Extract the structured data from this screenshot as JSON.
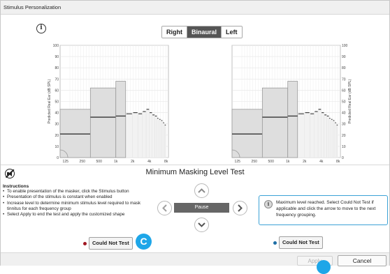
{
  "window": {
    "title": "Stimulus Personalization"
  },
  "ear_selector": {
    "options": [
      "Right",
      "Binaural",
      "Left"
    ],
    "selected": "Binaural"
  },
  "chart_data": [
    {
      "type": "bar",
      "ear": "right",
      "ylabel": "Predicted Real Ear (dB SPL)",
      "ylim": [
        0,
        100
      ],
      "yticks": [
        "0",
        "10",
        "20",
        "30",
        "40",
        "50",
        "60",
        "70",
        "80",
        "90",
        "100"
      ],
      "xticks": [
        "125",
        "250",
        "500",
        "1k",
        "2k",
        "4k",
        "8k"
      ],
      "bands": [
        {
          "from_hz": 100,
          "to_hz": 350,
          "top": 43,
          "level": 21
        },
        {
          "from_hz": 350,
          "to_hz": 1000,
          "top": 62,
          "level": 36
        },
        {
          "from_hz": 1000,
          "to_hz": 1500,
          "top": 68,
          "level": 37
        }
      ],
      "steps": [
        {
          "hz": 1750,
          "value": 39
        },
        {
          "hz": 2250,
          "value": 40
        },
        {
          "hz": 2750,
          "value": 39
        },
        {
          "hz": 3250,
          "value": 41
        },
        {
          "hz": 3750,
          "value": 43
        },
        {
          "hz": 4250,
          "value": 40
        },
        {
          "hz": 4750,
          "value": 38
        },
        {
          "hz": 5250,
          "value": 37
        },
        {
          "hz": 5750,
          "value": 35
        },
        {
          "hz": 6250,
          "value": 34
        },
        {
          "hz": 6750,
          "value": 33
        },
        {
          "hz": 7250,
          "value": 31
        },
        {
          "hz": 7750,
          "value": 29
        }
      ]
    },
    {
      "type": "bar",
      "ear": "left",
      "ylabel": "Predicted Real Ear (dB SPL)",
      "ylim": [
        0,
        100
      ],
      "yticks": [
        "0",
        "10",
        "20",
        "30",
        "40",
        "50",
        "60",
        "70",
        "80",
        "90",
        "100"
      ],
      "xticks": [
        "125",
        "250",
        "500",
        "1k",
        "2k",
        "4k",
        "8k"
      ],
      "bands": [
        {
          "from_hz": 100,
          "to_hz": 350,
          "top": 43,
          "level": 21
        },
        {
          "from_hz": 350,
          "to_hz": 1000,
          "top": 62,
          "level": 36
        },
        {
          "from_hz": 1000,
          "to_hz": 1500,
          "top": 68,
          "level": 37
        }
      ],
      "steps": [
        {
          "hz": 1750,
          "value": 39
        },
        {
          "hz": 2250,
          "value": 40
        },
        {
          "hz": 2750,
          "value": 39
        },
        {
          "hz": 3250,
          "value": 41
        },
        {
          "hz": 3750,
          "value": 43
        },
        {
          "hz": 4250,
          "value": 40
        },
        {
          "hz": 4750,
          "value": 38
        },
        {
          "hz": 5250,
          "value": 37
        },
        {
          "hz": 5750,
          "value": 35
        },
        {
          "hz": 6250,
          "value": 34
        },
        {
          "hz": 6750,
          "value": 33
        },
        {
          "hz": 7250,
          "value": 31
        },
        {
          "hz": 7750,
          "value": 29
        }
      ]
    }
  ],
  "test": {
    "title": "Minimum Masking Level Test",
    "pause_label": "Pause"
  },
  "instructions": {
    "heading": "Instructions",
    "items": [
      "To enable presentation of the masker, click the Stimulus button",
      "Presentation of the stimulus is constant when enabled",
      "Increase level to determine minimum stimulus level required to mask tinnitus for each frequency group",
      "Select Apply to end the test and apply the customized shape"
    ]
  },
  "notice": {
    "icon": "info-icon",
    "text": "Maximum level reached. Select Could Not Test if applicable and click the arrow to move to the next frequency grouping."
  },
  "right_ear": {
    "could_not_test_label": "Could Not Test",
    "color": "#a01822"
  },
  "left_ear": {
    "could_not_test_label": "Could Not Test",
    "color": "#1f6fa6"
  },
  "badge": {
    "letter": "C",
    "color": "#1ea6e8"
  },
  "footer": {
    "apply_label": "Apply",
    "cancel_label": "Cancel"
  }
}
